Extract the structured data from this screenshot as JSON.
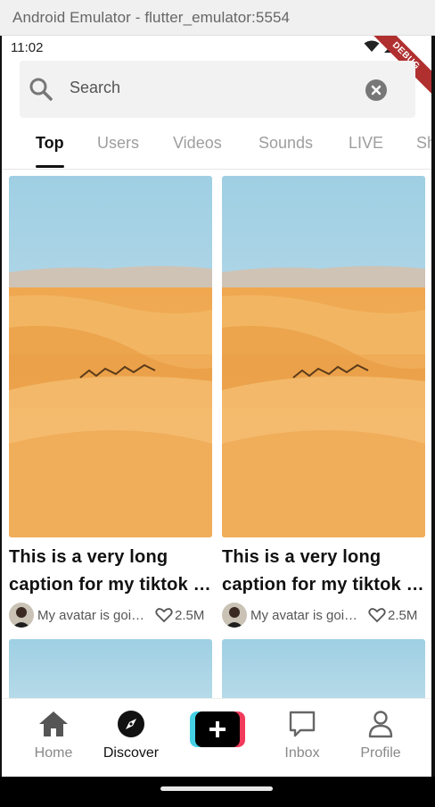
{
  "window": {
    "title": "Android Emulator - flutter_emulator:5554"
  },
  "status_bar": {
    "time": "11:02",
    "debug_label": "DEBUG"
  },
  "search": {
    "value": "Search",
    "icon": "search-icon",
    "clear_icon": "clear-icon"
  },
  "tabs": [
    {
      "label": "Top",
      "active": true
    },
    {
      "label": "Users",
      "active": false
    },
    {
      "label": "Videos",
      "active": false
    },
    {
      "label": "Sounds",
      "active": false
    },
    {
      "label": "LIVE",
      "active": false
    },
    {
      "label": "Shopping",
      "active": false
    }
  ],
  "videos": [
    {
      "caption_line1": "This is a very long",
      "caption_line2": "caption for my tiktok …",
      "username": "My avatar is goi…",
      "likes": "2.5M"
    },
    {
      "caption_line1": "This is a very long",
      "caption_line2": "caption for my tiktok …",
      "username": "My avatar is goi…",
      "likes": "2.5M"
    }
  ],
  "bottom_nav": [
    {
      "label": "Home",
      "icon": "home-icon",
      "active": false
    },
    {
      "label": "Discover",
      "icon": "compass-icon",
      "active": true
    },
    {
      "label": "",
      "icon": "plus-icon",
      "active": false
    },
    {
      "label": "Inbox",
      "icon": "message-icon",
      "active": false
    },
    {
      "label": "Profile",
      "icon": "person-icon",
      "active": false
    }
  ],
  "colors": {
    "create_cyan": "#45d1e6",
    "create_red": "#f23a5b",
    "debug_ribbon": "#b03030",
    "sky": "#a9d3e6",
    "sand": "#e8a34e"
  }
}
